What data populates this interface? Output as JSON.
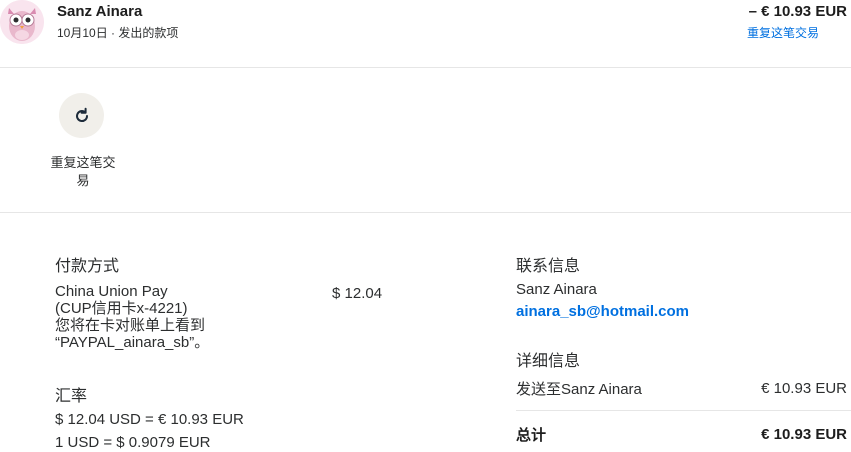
{
  "header": {
    "merchant_name": "Sanz Ainara",
    "meta": "10月10日 · 发出的款项",
    "amount": "– € 10.93 EUR",
    "repeat_link": "重复这笔交易"
  },
  "actions": {
    "repeat_label": "重复这笔交易"
  },
  "payment": {
    "title": "付款方式",
    "method_lines": [
      "China Union Pay",
      "(CUP信用卡x-4221)",
      "您将在卡对账单上看到",
      "“PAYPAL_ainara_sb”。"
    ],
    "amount": "$ 12.04"
  },
  "exchange": {
    "title": "汇率",
    "line1": "$ 12.04 USD = € 10.93 EUR",
    "line2": "1 USD = $ 0.9079 EUR"
  },
  "contact": {
    "title": "联系信息",
    "name": "Sanz Ainara",
    "email": "ainara_sb@hotmail.com"
  },
  "details": {
    "title": "详细信息",
    "sent_to_label": "发送至Sanz Ainara",
    "sent_to_value": "€ 10.93 EUR",
    "total_label": "总计",
    "total_value": "€ 10.93 EUR"
  },
  "colors": {
    "link": "#0070e0",
    "text": "#2c2e2f",
    "button_bg": "#f1efea"
  }
}
